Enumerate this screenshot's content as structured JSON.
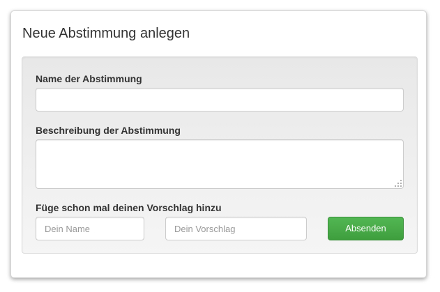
{
  "dialog": {
    "title": "Neue Abstimmung anlegen"
  },
  "form": {
    "name_label": "Name der Abstimmung",
    "name_value": "",
    "description_label": "Beschreibung der Abstimmung",
    "description_value": "",
    "suggestion_label": "Füge schon mal deinen Vorschlag hinzu",
    "your_name_placeholder": "Dein Name",
    "your_suggestion_placeholder": "Dein Vorschlag",
    "submit_label": "Absenden"
  },
  "colors": {
    "submit_button": "#47a947",
    "well_background": "#eeeeee"
  }
}
